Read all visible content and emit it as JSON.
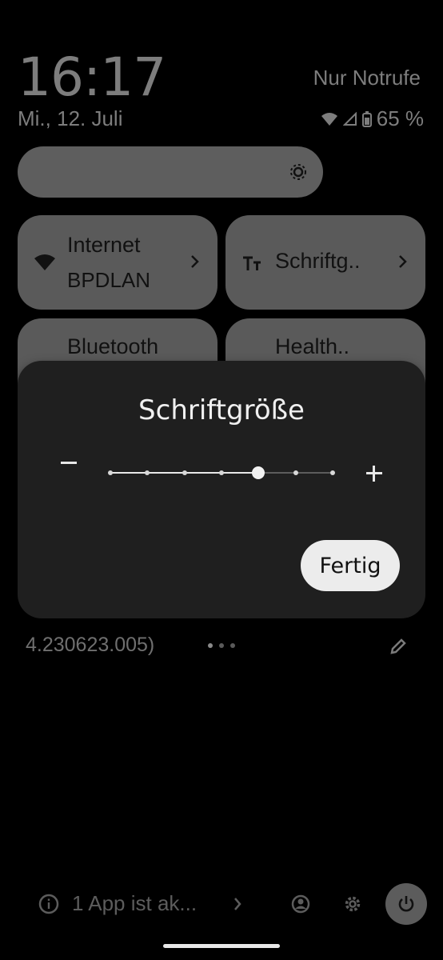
{
  "status_bar": {
    "time": "16:17",
    "date": "Mi., 12. Juli",
    "mode": "Nur Notrufe",
    "battery": "65 %"
  },
  "tiles": [
    {
      "label": "Internet",
      "sub": "BPDLAN"
    },
    {
      "label": "Schriftg.."
    },
    {
      "label": "Bluetooth"
    },
    {
      "label": "Health.."
    }
  ],
  "dialog": {
    "title": "Schriftgröße",
    "minus": "−",
    "plus": "+",
    "done": "Fertig",
    "slider_positions": 7,
    "slider_value_index": 4
  },
  "footer": {
    "build": "4.230623.005)",
    "page_dots": 3,
    "active_dot": 0,
    "app_notice": "1 App ist ak..."
  },
  "colors": {
    "background": "#000000",
    "tile": "#5a5a5a",
    "dialog": "#1f1f1f",
    "button": "#ececec"
  }
}
